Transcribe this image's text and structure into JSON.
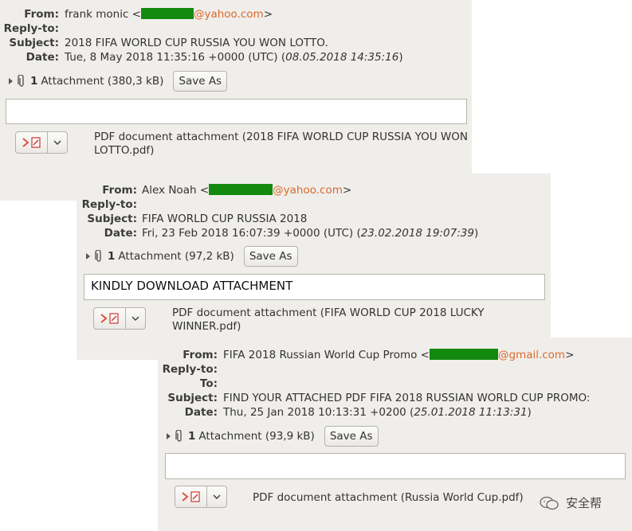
{
  "labels": {
    "from": "From:",
    "reply_to": "Reply-to:",
    "to": "To:",
    "subject": "Subject:",
    "date": "Date:"
  },
  "emails": [
    {
      "from_name": "frank monic <",
      "from_domain": "@yahoo.com",
      "from_close": ">",
      "subject": "2018 FIFA WORLD CUP RUSSIA YOU WON LOTTO.",
      "date": "Tue, 8 May 2018 11:35:16 +0000 (UTC) (",
      "date_local": "08.05.2018 14:35:16",
      "date_close": ")",
      "attachment_count": "1",
      "attachment_text": "Attachment (380,3 kB)",
      "save_as": "Save As",
      "body": "",
      "pdf_desc_line1": "PDF document attachment (2018 FIFA WORLD CUP RUSSIA YOU WON",
      "pdf_desc_line2": "LOTTO.pdf)"
    },
    {
      "from_name": "Alex Noah <",
      "from_domain": "@yahoo.com",
      "from_close": ">",
      "subject": "FIFA WORLD CUP RUSSIA 2018",
      "date": "Fri, 23 Feb 2018 16:07:39 +0000 (UTC) (",
      "date_local": "23.02.2018 19:07:39",
      "date_close": ")",
      "attachment_count": "1",
      "attachment_text": "Attachment (97,2 kB)",
      "save_as": "Save As",
      "body": "KINDLY DOWNLOAD ATTACHMENT",
      "pdf_desc_line1": "PDF document attachment (FIFA WORLD CUP 2018 LUCKY",
      "pdf_desc_line2": "WINNER.pdf)"
    },
    {
      "from_name": "FIFA 2018 Russian World Cup Promo <",
      "from_domain": "@gmail.com",
      "from_close": ">",
      "subject": "FIND YOUR ATTACHED PDF FIFA 2018 RUSSIAN WORLD CUP PROMO:",
      "date": "Thu, 25 Jan 2018 10:13:31 +0200 (",
      "date_local": "25.01.2018 11:13:31",
      "date_close": ")",
      "attachment_count": "1",
      "attachment_text": "Attachment (93,9 kB)",
      "save_as": "Save As",
      "body": "",
      "pdf_desc_line1": "PDF document attachment (Russia World Cup.pdf)"
    }
  ],
  "watermark": "安全帮",
  "colors": {
    "email_link": "#d96a2b",
    "redaction": "#138a0e",
    "panel_bg": "#f0eeeb"
  }
}
